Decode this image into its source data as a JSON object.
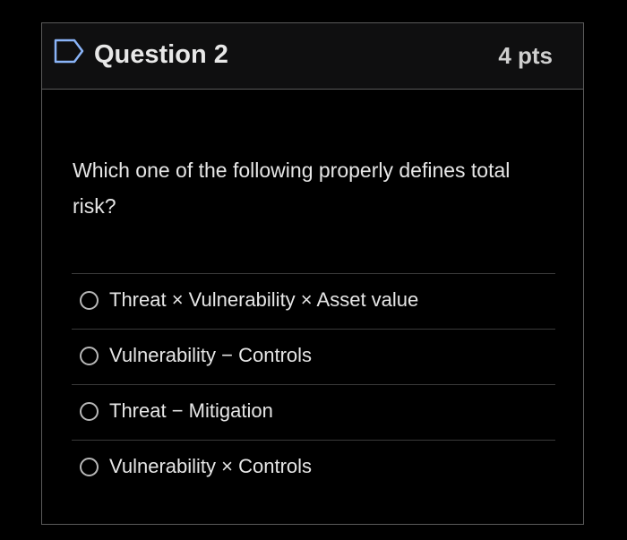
{
  "question": {
    "title": "Question 2",
    "points": "4 pts",
    "text": "Which one of the following properly defines total risk?",
    "flag_icon": "flag-outline-icon"
  },
  "answers": [
    {
      "label": "Threat × Vulnerability × Asset value",
      "selected": false
    },
    {
      "label": "Vulnerability − Controls",
      "selected": false
    },
    {
      "label": "Threat − Mitigation",
      "selected": false
    },
    {
      "label": "Vulnerability × Controls",
      "selected": false
    }
  ],
  "colors": {
    "background": "#000000",
    "header_background": "#0f0f10",
    "border": "#5a5a5a",
    "text": "#e6e6e6",
    "flag_outline": "#8ab4f8"
  }
}
